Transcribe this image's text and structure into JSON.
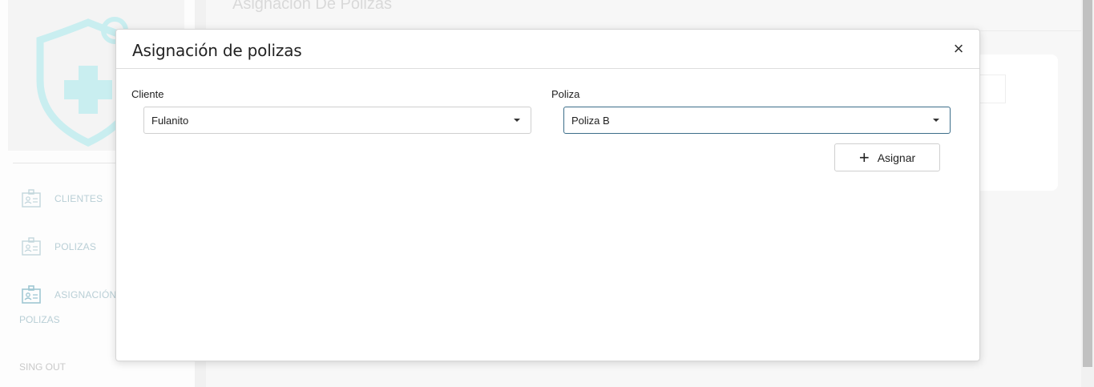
{
  "app": {
    "page_title": "Asignacion De Polizas"
  },
  "sidebar": {
    "items": [
      {
        "label": "CLIENTES",
        "icon": "id-card-icon"
      },
      {
        "label": "POLIZAS",
        "icon": "id-card-icon"
      },
      {
        "label": "ASIGNACIÓN",
        "icon": "id-card-icon"
      }
    ],
    "item3_wrap": "POLIZAS",
    "signout": "SING OUT",
    "logo_icon": "health-shield-icon",
    "accent_color": "#c9eef0"
  },
  "modal": {
    "title": "Asignación de polizas",
    "close_icon": "close-icon",
    "close_label": "×",
    "cliente": {
      "label": "Cliente",
      "value": "Fulanito"
    },
    "poliza": {
      "label": "Poliza",
      "value": "Poliza B"
    },
    "assign_button": {
      "label": "Asignar",
      "icon": "plus-icon",
      "icon_glyph": "+"
    }
  }
}
